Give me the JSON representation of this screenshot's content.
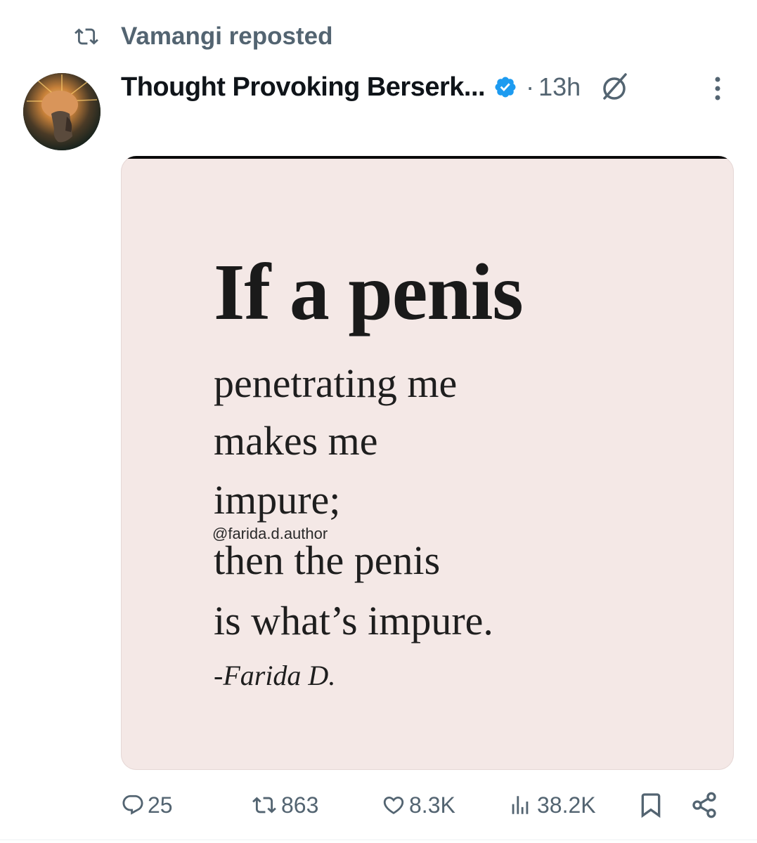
{
  "repost": {
    "text": "Vamangi reposted",
    "icon": "repost-icon"
  },
  "author": {
    "name": "Thought Provoking Berserk...",
    "verified": true,
    "verified_color": "#1d9bf0",
    "separator": "·",
    "time": "13h"
  },
  "media": {
    "title": "If a penis",
    "lines": [
      "penetrating me",
      "makes me",
      "impure;",
      "then the penis",
      "is what’s impure."
    ],
    "handle": "@farida.d.author",
    "attribution": "-Farida D.",
    "background": "#f4e8e6"
  },
  "actions": {
    "replies": "25",
    "reposts": "863",
    "likes": "8.3K",
    "views": "38.2K"
  },
  "colors": {
    "muted": "#536471",
    "text": "#0f1419"
  }
}
